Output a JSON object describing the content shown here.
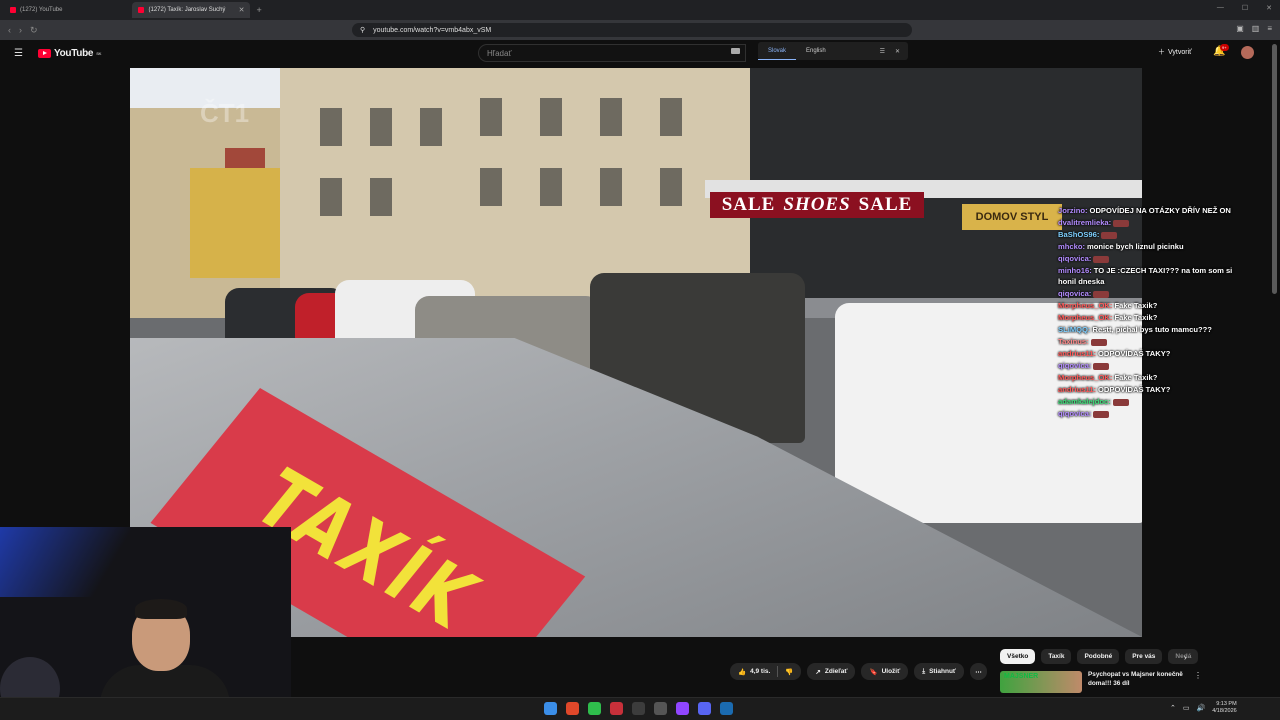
{
  "browser": {
    "tabs": [
      {
        "label": "(1272) YouTube",
        "active": false
      },
      {
        "label": "(1272) Taxík: Jaroslav Suchý",
        "active": true
      }
    ],
    "url": "youtube.com/watch?v=vmb4abx_vSM"
  },
  "youtube": {
    "logo_text": "YouTube",
    "region": "SK",
    "search_placeholder": "Hľadať",
    "create_label": "Vytvoriť",
    "notifications_badge": "9+"
  },
  "translator": {
    "languages": [
      "Slovak",
      "English"
    ],
    "selected": "Slovak"
  },
  "video": {
    "sale_sign": [
      "SALE",
      "SHOES",
      "SALE"
    ],
    "store_sign": "DOMOV STYL",
    "roof_sign": "TAXÍK",
    "channel_watermark": "ČT1"
  },
  "chat": [
    {
      "user": "Jorzino:",
      "color": "#b38cff",
      "msg": "ODPOVÍDEJ NA OTÁZKY DŘÍV NEŽ ON"
    },
    {
      "user": "dvalitremlieka:",
      "color": "#b38cff",
      "msg": ""
    },
    {
      "user": "BaShOS96:",
      "color": "#7fd0ff",
      "msg": ""
    },
    {
      "user": "mhcko:",
      "color": "#b38cff",
      "msg": "monice bych liznul picinku"
    },
    {
      "user": "qiqovica:",
      "color": "#b38cff",
      "msg": ""
    },
    {
      "user": "minho16:",
      "color": "#b38cff",
      "msg": "TO JE :CZECH TAXI??? na tom som si honil dneska"
    },
    {
      "user": "qiqovica:",
      "color": "#b38cff",
      "msg": ""
    },
    {
      "user": "Morpheus_OK:",
      "color": "#ff5a5a",
      "msg": "Fake Taxik?"
    },
    {
      "user": "Morpheus_OK:",
      "color": "#ff5a5a",
      "msg": "Fake Taxik?"
    },
    {
      "user": "SLiMQQ:",
      "color": "#7fd0ff",
      "msg": "Restt, pichal bys tuto mamcu???"
    },
    {
      "user": "Taxinus:",
      "color": "#ff8a8a",
      "msg": ""
    },
    {
      "user": "andrius11:",
      "color": "#ff5a5a",
      "msg": "ODPOVÍDAŠ TAKY?"
    },
    {
      "user": "qiqovica:",
      "color": "#b38cff",
      "msg": ""
    },
    {
      "user": "Morpheus_OK:",
      "color": "#ff5a5a",
      "msg": "Fake Taxik?"
    },
    {
      "user": "andrius11:",
      "color": "#ff5a5a",
      "msg": "ODPOVÍDAŠ TAKY?"
    },
    {
      "user": "adamkalejdoc:",
      "color": "#3fe07a",
      "msg": ""
    },
    {
      "user": "qiqovica:",
      "color": "#b38cff",
      "msg": ""
    }
  ],
  "actions": {
    "likes": "4,9 tis.",
    "share": "Zdieľať",
    "save": "Uložiť",
    "download": "Stiahnuť"
  },
  "chips": [
    "Všetko",
    "Taxík",
    "Podobné",
    "Pre vás",
    "Nedá"
  ],
  "recommendation": {
    "thumb_text": "MAJSNER",
    "title": "Psychopat vs Majsner konečně doma!!! 36 díl"
  },
  "taskbar": {
    "time": "9:13 PM",
    "date": "4/18/2026"
  }
}
